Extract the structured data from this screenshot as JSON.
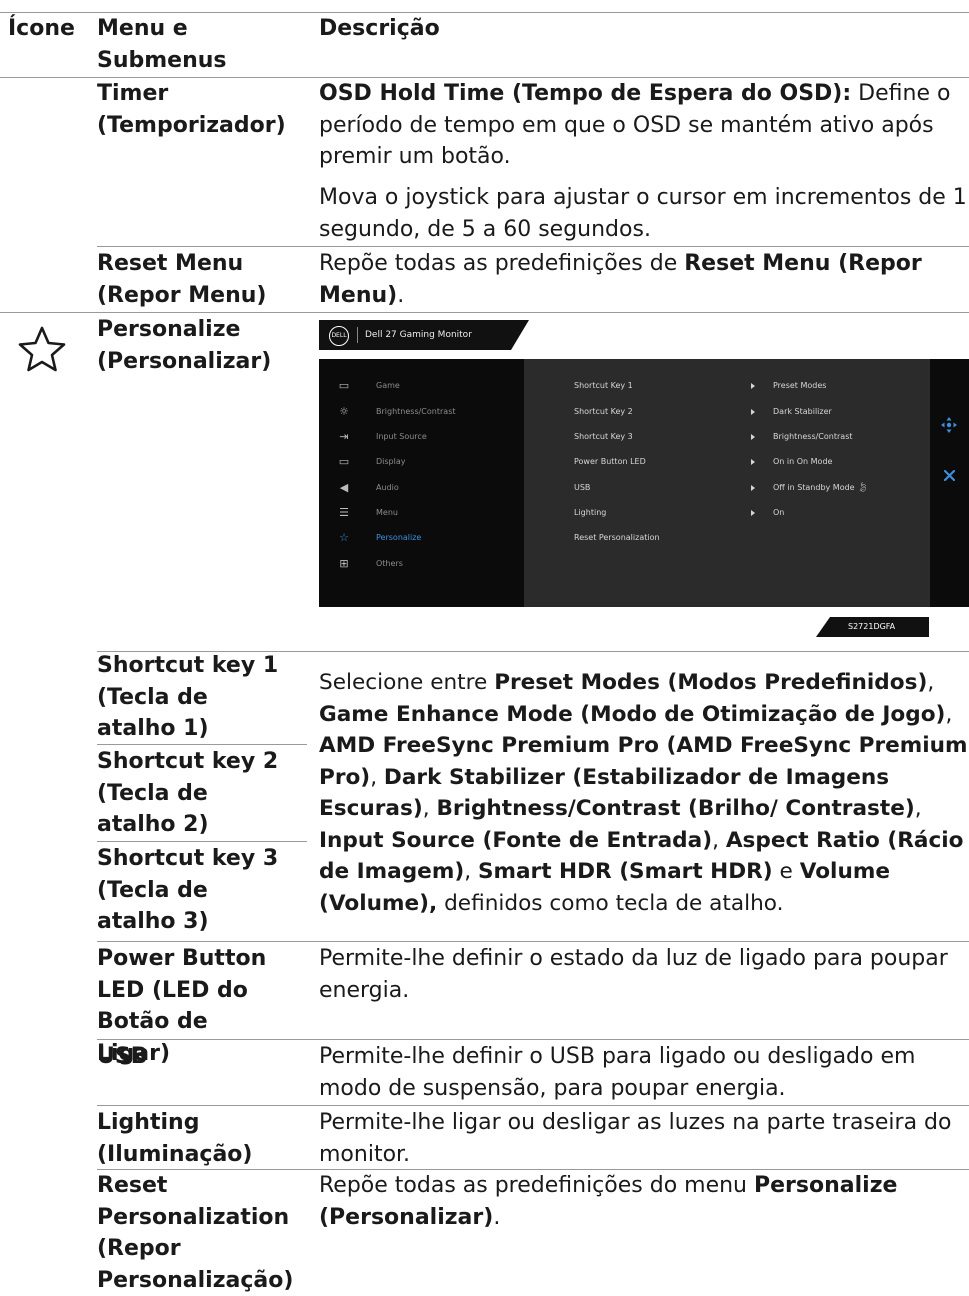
{
  "header": {
    "col_icon": "Ícone",
    "col_menu": "Menu e Submenus",
    "col_desc": "Descrição"
  },
  "rows": {
    "timer": {
      "menu": "Timer (Temporizador)",
      "p1_bold": "OSD Hold Time (Tempo de Espera do OSD):",
      "p1_rest": " Define o período de tempo em que o OSD se mantém ativo após premir um botão.",
      "p2": "Mova o joystick para ajustar o cursor em incrementos de 1 segundo, de 5 a 60 segundos."
    },
    "reset_menu": {
      "menu": "Reset Menu (Repor Menu)",
      "desc_pre": "Repõe todas as predefinições de ",
      "desc_bold": "Reset Menu (Repor Menu)",
      "desc_post": "."
    },
    "personalize": {
      "icon": "star-outline-icon",
      "menu": "Personalize (Personalizar)"
    },
    "shortcut1": {
      "menu": "Shortcut key 1 (Tecla de atalho 1)"
    },
    "shortcut2": {
      "menu": "Shortcut key 2 (Tecla de atalho 2)"
    },
    "shortcut3": {
      "menu": "Shortcut key 3 (Tecla de atalho 3)"
    },
    "shortcut_desc": {
      "a": "Selecione entre ",
      "b": "Preset Modes (Modos Predefinidos)",
      "c": ", ",
      "d": "Game Enhance Mode (Modo de Otimização de Jogo)",
      "e": ", ",
      "f": "AMD FreeSync Premium Pro (AMD FreeSync Premium Pro)",
      "g": ", ",
      "h": "Dark Stabilizer (Estabilizador de Imagens Escuras)",
      "i": ", ",
      "j": "Brightness/Contrast (Brilho/ Contraste)",
      "k": ", ",
      "l": "Input Source (Fonte de Entrada)",
      "m": ", ",
      "n": "Aspect Ratio (Rácio de Imagem)",
      "o": ", ",
      "p": "Smart HDR (Smart HDR)",
      "q": " e ",
      "r": "Volume (Volume),",
      "s": " definidos como tecla de atalho."
    },
    "power_led": {
      "menu": "Power Button LED (LED do Botão de Ligar)",
      "desc": "Permite-lhe definir o estado da luz de ligado para poupar energia."
    },
    "usb": {
      "menu": "USB",
      "desc": "Permite-lhe definir o USB para ligado ou desligado em modo de suspensão, para poupar energia."
    },
    "lighting": {
      "menu": "Lighting (Iluminação)",
      "desc": "Permite-lhe ligar ou desligar as luzes na parte traseira do monitor."
    },
    "reset_personalization": {
      "menu": "Reset Personalization (Repor Personalização)",
      "desc_pre": "Repõe todas as predefinições do menu ",
      "desc_bold": "Personalize (Personalizar)",
      "desc_post": "."
    }
  },
  "osd": {
    "logo": "DELL",
    "title": "Dell 27 Gaming Monitor",
    "menu": [
      {
        "label": "Game",
        "icon": "game-icon",
        "glyph": "▭"
      },
      {
        "label": "Brightness/Contrast",
        "icon": "brightness-icon",
        "glyph": "☼"
      },
      {
        "label": "Input Source",
        "icon": "input-source-icon",
        "glyph": "⇥"
      },
      {
        "label": "Display",
        "icon": "display-icon",
        "glyph": "▭"
      },
      {
        "label": "Audio",
        "icon": "audio-icon",
        "glyph": "◀"
      },
      {
        "label": "Menu",
        "icon": "menu-icon",
        "glyph": "☰"
      },
      {
        "label": "Personalize",
        "icon": "star-icon",
        "glyph": "☆",
        "active": true
      },
      {
        "label": "Others",
        "icon": "others-icon",
        "glyph": "⊞"
      }
    ],
    "settings": [
      {
        "name": "Shortcut Key 1",
        "value": "Preset Modes"
      },
      {
        "name": "Shortcut Key 2",
        "value": "Dark Stabilizer"
      },
      {
        "name": "Shortcut Key 3",
        "value": "Brightness/Contrast"
      },
      {
        "name": "Power Button LED",
        "value": "On in On Mode"
      },
      {
        "name": "USB",
        "value": "Off in Standby Mode"
      },
      {
        "name": "Lighting",
        "value": "On"
      },
      {
        "name": "Reset Personalization",
        "value": ""
      }
    ],
    "model": "S2721DGFA",
    "accent": "#3d8fe0"
  }
}
